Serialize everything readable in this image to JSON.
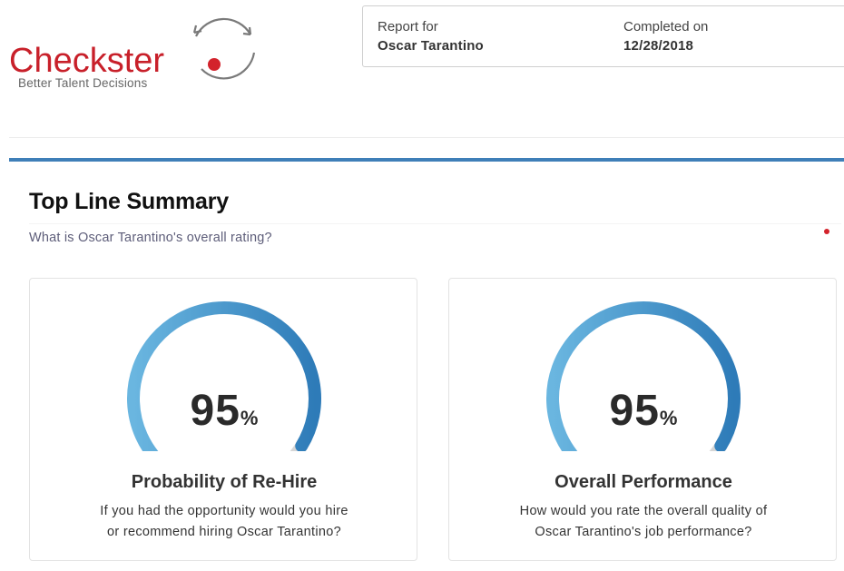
{
  "logo": {
    "wordmark": "Checkster",
    "tagline": "Better Talent Decisions",
    "brand_color": "#c8202a",
    "icon": "circular-arrows-icon"
  },
  "report": {
    "report_for_label": "Report for",
    "candidate_name": "Oscar Tarantino",
    "completed_label": "Completed on",
    "completed_date": "12/28/2018"
  },
  "summary": {
    "title": "Top Line Summary",
    "question": "What is Oscar Tarantino's overall rating?",
    "accent_color": "#3f7fb8"
  },
  "metrics": [
    {
      "value": "95",
      "unit": "%",
      "fraction": 0.95,
      "title": "Probability of Re-Hire",
      "question_line1": "If you had the opportunity would you hire",
      "question_line2": "or recommend hiring Oscar Tarantino?"
    },
    {
      "value": "95",
      "unit": "%",
      "fraction": 0.95,
      "title": "Overall Performance",
      "question_line1": "How would you rate the overall quality of",
      "question_line2": "Oscar Tarantino's job performance?"
    }
  ],
  "gauge_colors": {
    "start": "#6ab6e0",
    "end": "#2e7bb8",
    "track": "#d6d6d6"
  }
}
